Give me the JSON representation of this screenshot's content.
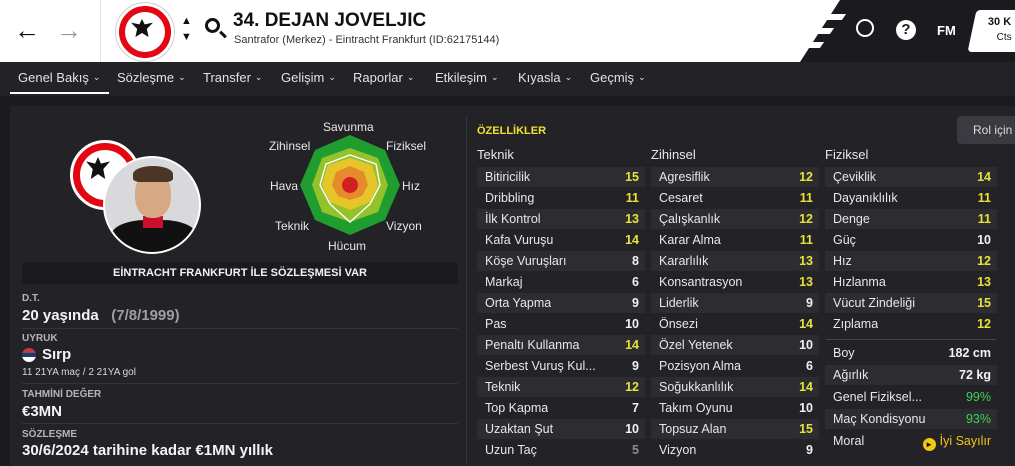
{
  "header": {
    "back_icon": "←",
    "forward_icon": "→",
    "player_name": "34. DEJAN JOVELJIC",
    "player_sub": "Santrafor (Merkez) - Eintracht Frankfurt (ID:62175144)",
    "fm_label": "FM",
    "help_label": "?",
    "date_top": "30 K",
    "date_bottom": "Cts"
  },
  "tabs": [
    {
      "label": "Genel Bakış"
    },
    {
      "label": "Sözleşme"
    },
    {
      "label": "Transfer"
    },
    {
      "label": "Gelişim"
    },
    {
      "label": "Raporlar"
    },
    {
      "label": "Etkileşim"
    },
    {
      "label": "Kıyasla"
    },
    {
      "label": "Geçmiş"
    }
  ],
  "profile": {
    "contract_banner": "EİNTRACHT FRANKFURT İLE SÖZLEŞMESİ VAR",
    "dob_label": "D.T.",
    "age": "20 yaşında",
    "dob": "(7/8/1999)",
    "nationality_label": "UYRUK",
    "nationality": "Sırp",
    "caps": "11 21YA maç / 2 21YA gol",
    "value_label": "TAHMİNİ DEĞER",
    "value": "€3MN",
    "contract_label": "SÖZLEŞME",
    "contract": "30/6/2024 tarihine kadar €1MN yıllık"
  },
  "radar": {
    "top": "Savunma",
    "top_left": "Zihinsel",
    "top_right": "Fiziksel",
    "left": "Hava",
    "right": "Hız",
    "bottom_left": "Teknik",
    "bottom_right": "Vizyon",
    "bottom": "Hücum"
  },
  "attributes": {
    "title": "ÖZELLİKLER",
    "role_button": "Rol için",
    "technical_header": "Teknik",
    "mental_header": "Zihinsel",
    "physical_header": "Fiziksel",
    "technical": [
      {
        "name": "Bitiricilik",
        "value": "15"
      },
      {
        "name": "Dribbling",
        "value": "11"
      },
      {
        "name": "İlk Kontrol",
        "value": "13"
      },
      {
        "name": "Kafa Vuruşu",
        "value": "14"
      },
      {
        "name": "Köşe Vuruşları",
        "value": "8"
      },
      {
        "name": "Markaj",
        "value": "6"
      },
      {
        "name": "Orta Yapma",
        "value": "9"
      },
      {
        "name": "Pas",
        "value": "10"
      },
      {
        "name": "Penaltı Kullanma",
        "value": "14"
      },
      {
        "name": "Serbest Vuruş Kul...",
        "value": "9"
      },
      {
        "name": "Teknik",
        "value": "12"
      },
      {
        "name": "Top Kapma",
        "value": "7"
      },
      {
        "name": "Uzaktan Şut",
        "value": "10"
      },
      {
        "name": "Uzun Taç",
        "value": "5"
      }
    ],
    "mental": [
      {
        "name": "Agresiflik",
        "value": "12"
      },
      {
        "name": "Cesaret",
        "value": "11"
      },
      {
        "name": "Çalışkanlık",
        "value": "12"
      },
      {
        "name": "Karar Alma",
        "value": "11"
      },
      {
        "name": "Kararlılık",
        "value": "13"
      },
      {
        "name": "Konsantrasyon",
        "value": "13"
      },
      {
        "name": "Liderlik",
        "value": "9"
      },
      {
        "name": "Önsezi",
        "value": "14"
      },
      {
        "name": "Özel Yetenek",
        "value": "10"
      },
      {
        "name": "Pozisyon Alma",
        "value": "6"
      },
      {
        "name": "Soğukkanlılık",
        "value": "14"
      },
      {
        "name": "Takım Oyunu",
        "value": "10"
      },
      {
        "name": "Topsuz Alan",
        "value": "15"
      },
      {
        "name": "Vizyon",
        "value": "9"
      }
    ],
    "physical": [
      {
        "name": "Çeviklik",
        "value": "14"
      },
      {
        "name": "Dayanıklılık",
        "value": "11"
      },
      {
        "name": "Denge",
        "value": "11"
      },
      {
        "name": "Güç",
        "value": "10"
      },
      {
        "name": "Hız",
        "value": "12"
      },
      {
        "name": "Hızlanma",
        "value": "13"
      },
      {
        "name": "Vücut Zindeliği",
        "value": "15"
      },
      {
        "name": "Zıplama",
        "value": "12"
      }
    ],
    "extras": [
      {
        "name": "Boy",
        "value": "182 cm"
      },
      {
        "name": "Ağırlık",
        "value": "72 kg"
      },
      {
        "name": "Genel Fiziksel...",
        "value": "99%"
      },
      {
        "name": "Maç Kondisyonu",
        "value": "93%"
      },
      {
        "name": "Moral",
        "value": "İyi Sayılır"
      }
    ]
  },
  "colors": {
    "high": "#e6e23a",
    "mid": "#f2f2f2",
    "low": "#8c8c92",
    "good": "#3fd15a"
  }
}
